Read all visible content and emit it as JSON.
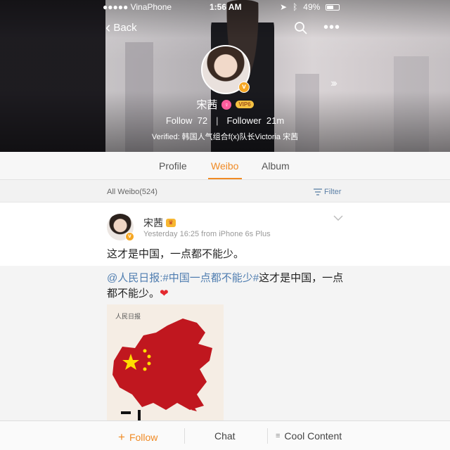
{
  "statusbar": {
    "carrier": "●●●●● VinaPhone",
    "time": "1:56 AM",
    "battery": "49%"
  },
  "nav": {
    "back_label": "Back"
  },
  "profile": {
    "name": "宋茜",
    "vip_label": "VIP6",
    "follow_label": "Follow",
    "follow_count": "72",
    "follower_label": "Follower",
    "follower_count": "21m",
    "verified": "Verified: 韩国人气组合f(x)队长Victoria 宋茜"
  },
  "tabs": [
    {
      "label": "Profile"
    },
    {
      "label": "Weibo"
    },
    {
      "label": "Album"
    }
  ],
  "filterbar": {
    "all_label": "All Weibo(524)",
    "filter_label": "Filter"
  },
  "post": {
    "author": "宋茜",
    "time": "Yesterday 16:25",
    "source": "from iPhone 6s Plus",
    "text": "这才是中国，一点都不能少。"
  },
  "repost": {
    "mention": "@人民日报",
    "colon": ":",
    "hashtag": "#中国一点都不能少#",
    "text": "这才是中国，一点都不能少。",
    "heart": "❤",
    "image_logo": "人民日报"
  },
  "bottombar": {
    "follow": "Follow",
    "chat": "Chat",
    "cool": "Cool Content"
  },
  "colors": {
    "accent": "#f08a24",
    "link": "#4f7db0",
    "flag_red": "#c0171f"
  }
}
